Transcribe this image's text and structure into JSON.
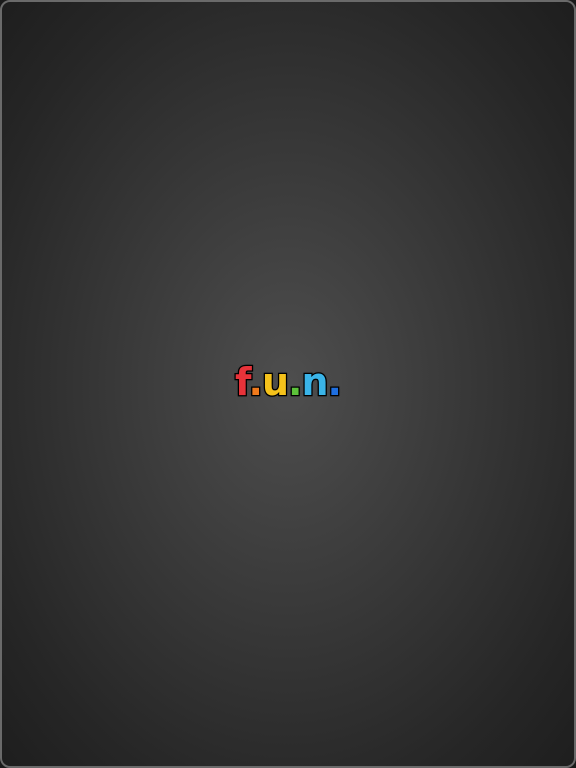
{
  "splash": {
    "logo": {
      "parts": [
        {
          "text": "f",
          "color": "#e8333a"
        },
        {
          "text": ".",
          "color": "#f07a1c"
        },
        {
          "text": "u",
          "color": "#f5c21b"
        },
        {
          "text": ".",
          "color": "#5cc23a"
        },
        {
          "text": "n",
          "color": "#3ab4e8"
        },
        {
          "text": ".",
          "color": "#1f6fe0"
        }
      ]
    }
  }
}
